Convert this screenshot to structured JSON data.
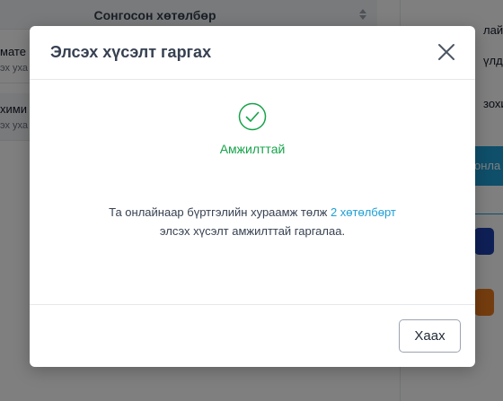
{
  "background": {
    "column_header": "Сонгосон хөтөлбөр",
    "rows": [
      {
        "title": "мате",
        "subtitle": "эх уха"
      },
      {
        "title": "хими",
        "subtitle": "эх уха"
      }
    ],
    "right_partial_texts": [
      "лайн",
      "үлд",
      "зохи"
    ],
    "right_button_label": "онла"
  },
  "modal": {
    "title": "Элсэх хүсэлт гаргах",
    "status": "Амжилттай",
    "message_before": "Та онлайнаар бүртгэлийн хураамж төлж ",
    "message_link": "2 хөтөлбөрт",
    "message_after": "элсэх хүсэлт амжилттай гаргалаа.",
    "close_button_label": "Хаах"
  },
  "colors": {
    "success": "#16a34a",
    "link": "#1e9fd4",
    "overlay": "rgba(0,0,0,0.5)"
  }
}
